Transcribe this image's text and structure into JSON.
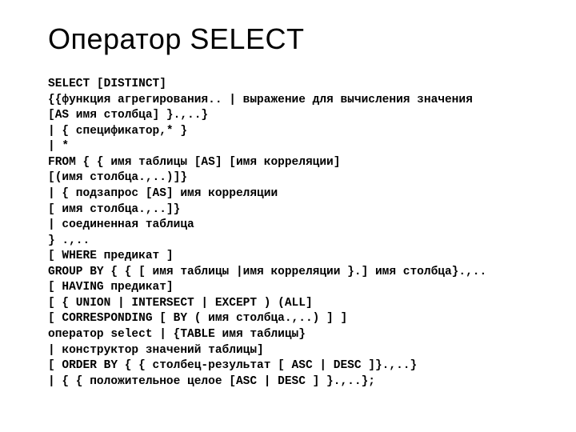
{
  "title": "Оператор SELECT",
  "syntax": {
    "l1": "SELECT [DISTINCT]",
    "l2": "{{функция агрегирования.. | выражение для вычисления значения",
    "l3": "[AS имя столбца] }.,..}",
    "l4": "| { спецификатор,* }",
    "l5": "| *",
    "l6": "FROM { { имя таблицы [AS] [имя корреляции]",
    "l7": "[(имя столбца.,..)]}",
    "l8": "| { подзапрос [AS] имя корреляции",
    "l9": "[ имя столбца.,..]}",
    "l10": "| соединенная таблица",
    "l11": "} .,..",
    "l12": "[ WHERE предикат ]",
    "l13": "GROUP BY { { [ имя таблицы |имя корреляции }.] имя столбца}.,..",
    "l14": "[ HAVING предикат]",
    "l15": "[ { UNION | INTERSECT | EXCEPT ) (ALL]",
    "l16": "[ CORRESPONDING [ BY ( имя столбца.,..) ] ]",
    "l17": "оператор select | {TABLE имя таблицы}",
    "l18": "| конструктор значений таблицы]",
    "l19": "[ ORDER BY { { столбец-результат [ ASC | DESC ]}.,..}",
    "l20": "| { { положительное целое [ASC | DESC ] }.,..};"
  }
}
